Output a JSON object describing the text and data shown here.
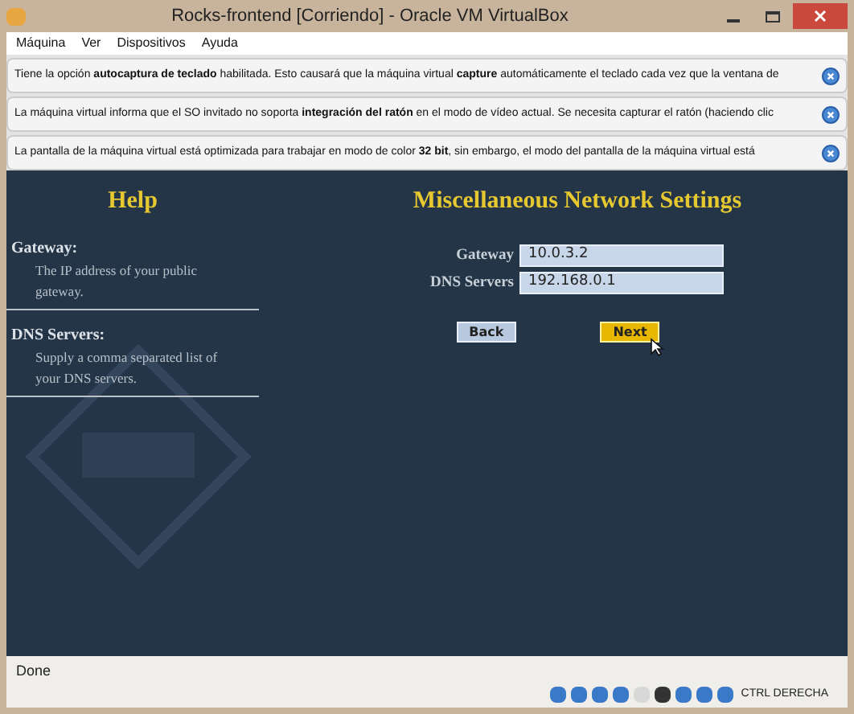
{
  "window": {
    "title": "Rocks-frontend [Corriendo] - Oracle VM VirtualBox"
  },
  "menu": [
    "Máquina",
    "Ver",
    "Dispositivos",
    "Ayuda"
  ],
  "notices": [
    {
      "text": "Tiene la opción **autocaptura de teclado** habilitada. Esto causará que la máquina virtual **capture** automáticamente el teclado cada vez que la ventana de"
    },
    {
      "text": "La máquina virtual informa que el SO invitado no soporta **integración del ratón** en el modo de vídeo actual. Se necesita capturar el ratón (haciendo clic"
    },
    {
      "text": "La pantalla de la máquina virtual está optimizada para trabajar en modo de color **32 bit**, sin embargo, el modo del pantalla de la máquina virtual está"
    }
  ],
  "help": {
    "title": "Help",
    "items": [
      {
        "term": "Gateway:",
        "desc": "The IP address of your public gateway."
      },
      {
        "term": "DNS Servers:",
        "desc": "Supply a comma separated list of your DNS servers."
      }
    ]
  },
  "form": {
    "title": "Miscellaneous Network Settings",
    "fields": [
      {
        "label": "Gateway",
        "value": "10.0.3.2"
      },
      {
        "label": "DNS Servers",
        "value": "192.168.0.1"
      }
    ],
    "buttons": [
      {
        "label": "Back",
        "kind": "secondary"
      },
      {
        "label": "Next",
        "kind": "primary"
      }
    ]
  },
  "status": "Done",
  "host_key": "CTRL DERECHA"
}
